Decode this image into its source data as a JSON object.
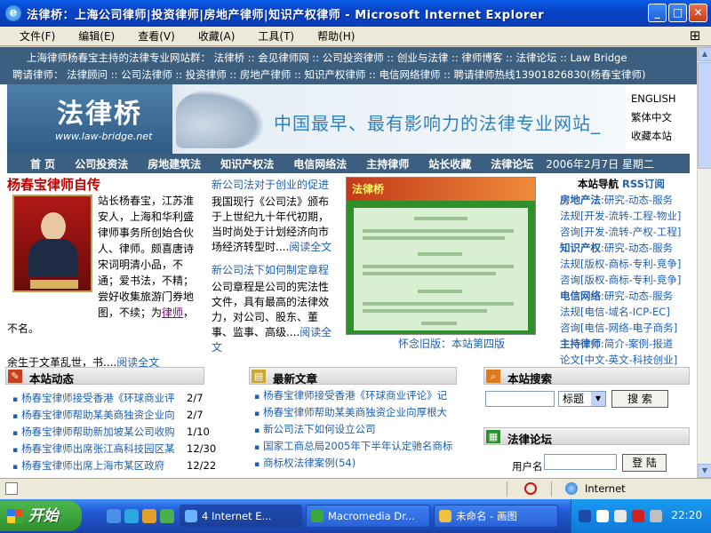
{
  "window": {
    "title": "法律桥：上海公司律师|投资律师|房地产律师|知识产权律师 - Microsoft Internet Explorer",
    "minimize": "_",
    "maximize": "□",
    "close": "✕"
  },
  "menu": [
    "文件(F)",
    "编辑(E)",
    "查看(V)",
    "收藏(A)",
    "工具(T)",
    "帮助(H)"
  ],
  "top_links": {
    "row1": "上海律师杨春宝主持的法律专业网站群： 法律桥 :: 会见律师网 :: 公司投资律师 :: 创业与法律 :: 律师博客 :: 法律论坛 :: Law Bridge",
    "row2": "聘请律师： 法律顾问 :: 公司法律师 :: 投资律师 :: 房地产律师 :: 知识产权律师 :: 电信网络律师 :: 聘请律师热线13901826830(杨春宝律师)"
  },
  "banner": {
    "logo_cn": "法律桥",
    "logo_url": "www.law-bridge.net",
    "slogan": "中国最早、最有影响力的法律专业网站_",
    "lang_links": [
      "ENGLISH",
      "繁体中文",
      "收藏本站"
    ]
  },
  "nav": {
    "items": [
      "首 页",
      "公司投资法",
      "房地建筑法",
      "知识产权法",
      "电信网络法",
      "主持律师",
      "站长收藏",
      "法律论坛"
    ],
    "date": "2006年2月7日 星期二"
  },
  "bio": {
    "title": "杨春宝律师自传",
    "lines": [
      "站长杨春宝，江苏淮",
      "安人，上海和华利盛",
      "律师事务所创始合伙",
      "人、律师。颇喜唐诗",
      "宋词明清小品，不",
      "通；爱书法，不精；",
      "尝好收集旅游门券地",
      "图，不续；为"
    ],
    "link": "律师",
    "tail": "，",
    "tail2": "不名。",
    "more_text": "余生于文革乱世，书....",
    "more_link": "阅读全文"
  },
  "articles": [
    {
      "title": "新公司法对于创业的促进",
      "lines": [
        "  我国现行《公司法》颁布",
        "于上世纪九十年代初期，",
        "当时尚处于计划经济向市",
        "场经济转型时...."
      ],
      "more": "阅读全文"
    },
    {
      "title": "新公司法下如何制定章程",
      "lines": [
        "  公司章程是公司的宪法性",
        "文件，具有最高的法律效",
        "力，对公司、股东、董",
        "事、监事、高级...."
      ],
      "more": "阅读全文"
    }
  ],
  "old_site": {
    "logo": "法律桥",
    "caption": "怀念旧版：本站第四版"
  },
  "site_nav": {
    "head": "本站导航",
    "rss": "RSS订阅",
    "rows": [
      {
        "bold": "房地产法",
        "text": ":研究-动态-服务"
      },
      {
        "bold": "",
        "text": "法规[开发-流转-工程-物业]"
      },
      {
        "bold": "",
        "text": "咨询[开发-流转-产权-工程]"
      },
      {
        "bold": "知识产权",
        "text": ":研究-动态-服务"
      },
      {
        "bold": "",
        "text": "法规[版权-商标-专利-竞争]"
      },
      {
        "bold": "",
        "text": "咨询[版权-商标-专利-竞争]"
      },
      {
        "bold": "电信网络",
        "text": ":研究-动态-服务"
      },
      {
        "bold": "",
        "text": "法规[电信-域名-ICP-EC]"
      },
      {
        "bold": "",
        "text": "咨询[电信-网络-电子商务]"
      },
      {
        "bold": "主持律师",
        "text": ":简介-案例-报道"
      },
      {
        "bold": "",
        "text": "论文[中文-英文-科技创业]"
      }
    ]
  },
  "sections": {
    "news": "本站动态",
    "latest": "最新文章",
    "search": "本站搜索",
    "forum": "法律论坛"
  },
  "news_items": [
    {
      "text": "杨春宝律师接受香港《环球商业评",
      "date": "2/7"
    },
    {
      "text": "杨春宝律师帮助某美商独资企业向",
      "date": "2/7"
    },
    {
      "text": "杨春宝律师帮助新加坡某公司收购",
      "date": "1/10"
    },
    {
      "text": "杨春宝律师出席张江高科技园区某",
      "date": "12/30"
    },
    {
      "text": "杨春宝律师出席上海市某区政府",
      "date": "12/22"
    }
  ],
  "latest_items": [
    "杨春宝律师接受香港《环球商业评论》记",
    "杨春宝律师帮助某美商独资企业向厚根大",
    "新公司法下如何设立公司",
    "国家工商总局2005年下半年认定驰名商标",
    "商标权法律案例(54)"
  ],
  "search": {
    "select_value": "标题",
    "button": "搜 索"
  },
  "login": {
    "label": "用户名",
    "button": "登 陆"
  },
  "status": {
    "zone": "Internet"
  },
  "taskbar": {
    "start": "开始",
    "tasks": [
      "4 Internet E...",
      "Macromedia Dr...",
      "未命名 - 画图"
    ],
    "clock": "22:20"
  },
  "colors": {
    "nav_bg": "#3c5f7f",
    "link": "#1f5fb0",
    "accent_red": "#c00000"
  }
}
